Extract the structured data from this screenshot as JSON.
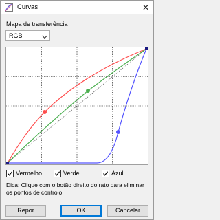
{
  "window": {
    "title": "Curvas",
    "close_glyph": "✕",
    "app_icon": "curves-icon"
  },
  "transfer_map": {
    "label": "Mapa de transferência",
    "selected": "RGB",
    "icon": "chevron-down-icon"
  },
  "curves": {
    "colors": {
      "red": "#ff4c4c",
      "green": "#4caf50",
      "blue": "#5454ff",
      "grid": "#000000",
      "identity": "#555555"
    }
  },
  "channels": [
    {
      "label": "Vermelho",
      "checked": true
    },
    {
      "label": "Verde",
      "checked": true
    },
    {
      "label": "Azul",
      "checked": true
    }
  ],
  "hint": "Dica: Clique com o botão direito do rato para eliminar os pontos de controlo.",
  "buttons": {
    "reset": "Repor",
    "ok": "OK",
    "cancel": "Cancelar"
  }
}
